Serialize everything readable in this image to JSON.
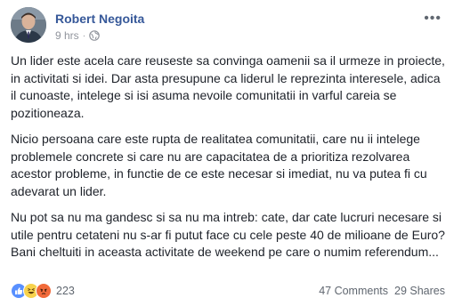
{
  "post": {
    "author": "Robert Negoita",
    "time": "9 hrs",
    "separator": "·",
    "more_icon": "more-horizontal-icon",
    "privacy_icon": "globe-icon",
    "paragraphs": [
      "Un lider este acela care reuseste sa convinga oamenii sa il urmeze in proiecte, in activitati si idei. Dar asta presupune ca liderul le reprezinta interesele, adica il cunoaste, intelege si isi asuma nevoile comunitatii in varful careia se pozitioneaza.",
      "Nicio persoana care este rupta de realitatea comunitatii, care nu ii intelege problemele concrete si care nu are capacitatea de a prioritiza rezolvarea acestor probleme, in functie de ce este necesar si imediat, nu va putea fi cu adevarat un lider.",
      "Nu pot sa nu ma gandesc si sa nu ma intreb: cate, dar cate lucruri necesare si utile pentru cetateni nu s-ar fi putut face cu cele peste 40 de milioane de Euro? Bani cheltuiti in aceasta activitate de weekend pe care o numim referendum..."
    ]
  },
  "footer": {
    "reaction_icons": [
      "like-icon",
      "haha-icon",
      "angry-icon"
    ],
    "reaction_count": "223",
    "comments": "47 Comments",
    "shares": "29 Shares"
  },
  "colors": {
    "author": "#365899",
    "meta": "#90949c",
    "like": "#5890ff",
    "haha": "#f7d24c",
    "angry": "#f16a3a"
  }
}
